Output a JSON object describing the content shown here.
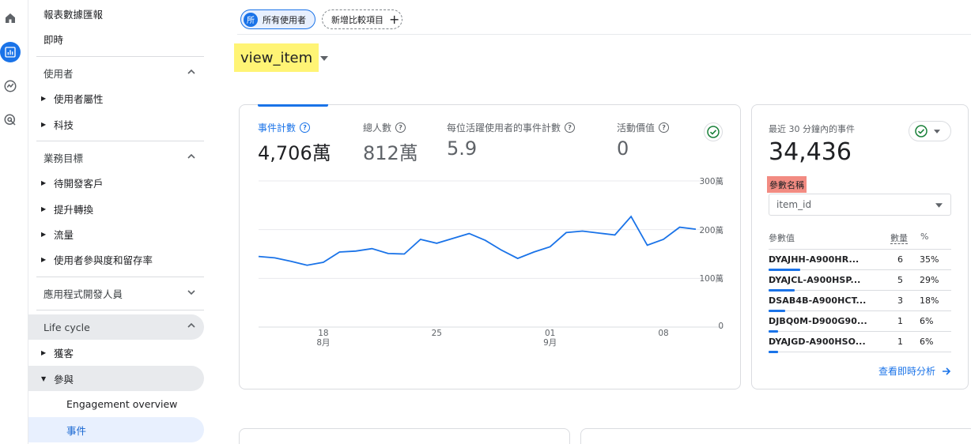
{
  "sidebar": {
    "report_snapshot": "報表數據匯報",
    "realtime": "即時",
    "user_section": "使用者",
    "user_attributes": "使用者屬性",
    "tech": "科技",
    "business_section": "業務目標",
    "generate_leads": "待開發客戶",
    "drive_sales": "提升轉換",
    "traffic": "流量",
    "engagement_retention": "使用者參與度和留存率",
    "app_developer": "應用程式開發人員",
    "lifecycle": "Life cycle",
    "acquisition": "獲客",
    "engagement": "參與",
    "engagement_overview": "Engagement overview",
    "events": "事件"
  },
  "topbar": {
    "segment_letter": "所",
    "segment_label": "所有使用者",
    "add_compare": "新增比較項目"
  },
  "page_title": "view_item",
  "metrics": [
    {
      "label": "事件計數",
      "value": "4,706萬"
    },
    {
      "label": "總人數",
      "value": "812萬"
    },
    {
      "label": "每位活躍使用者的事件計數",
      "value": "5.9"
    },
    {
      "label": "活動價值",
      "value": "0"
    }
  ],
  "chart_data": {
    "type": "line",
    "y_tick_labels": [
      "300萬",
      "200萬",
      "100萬",
      "0"
    ],
    "x_tick_labels": [
      {
        "day": "18",
        "month": "8月"
      },
      {
        "day": "25",
        "month": ""
      },
      {
        "day": "01",
        "month": "9月"
      },
      {
        "day": "08",
        "month": ""
      }
    ],
    "ylim": [
      0,
      3000000
    ],
    "x": [
      "08-14",
      "08-15",
      "08-16",
      "08-17",
      "08-18",
      "08-19",
      "08-20",
      "08-21",
      "08-22",
      "08-23",
      "08-24",
      "08-25",
      "08-26",
      "08-27",
      "08-28",
      "08-29",
      "08-30",
      "08-31",
      "09-01",
      "09-02",
      "09-03",
      "09-04",
      "09-05",
      "09-06",
      "09-07",
      "09-08",
      "09-09",
      "09-10"
    ],
    "series": [
      {
        "color": "#1a73e8",
        "values": [
          1450000,
          1420000,
          1350000,
          1270000,
          1330000,
          1540000,
          1560000,
          1610000,
          1510000,
          1500000,
          1800000,
          1720000,
          1820000,
          1920000,
          1780000,
          1580000,
          1410000,
          1540000,
          1650000,
          1940000,
          1970000,
          1930000,
          1890000,
          2270000,
          1680000,
          1800000,
          2050000,
          2010000
        ]
      }
    ],
    "grid": true,
    "legend": "none"
  },
  "realtime_card": {
    "subtitle": "最近 30 分鐘內的事件",
    "total": "34,436",
    "param_name_label": "參數名稱",
    "param_select": "item_id",
    "col_value": "參數值",
    "col_count": "數量",
    "col_pct": "%",
    "rows": [
      {
        "key": "DYAJHH-A900HR...",
        "count": "6",
        "pct": "35%",
        "frac": 0.35
      },
      {
        "key": "DYAJCL-A900HSP...",
        "count": "5",
        "pct": "29%",
        "frac": 0.29
      },
      {
        "key": "DSAB4B-A900HCT...",
        "count": "3",
        "pct": "18%",
        "frac": 0.18
      },
      {
        "key": "DJBQ0M-D900G90...",
        "count": "1",
        "pct": "6%",
        "frac": 0.06
      },
      {
        "key": "DYAJGD-A900HSO...",
        "count": "1",
        "pct": "6%",
        "frac": 0.06
      }
    ],
    "view_realtime": "查看即時分析"
  },
  "colors": {
    "accent": "#1a73e8",
    "highlight_yellow": "#fff475",
    "highlight_red": "#f28b82",
    "success": "#188038"
  }
}
